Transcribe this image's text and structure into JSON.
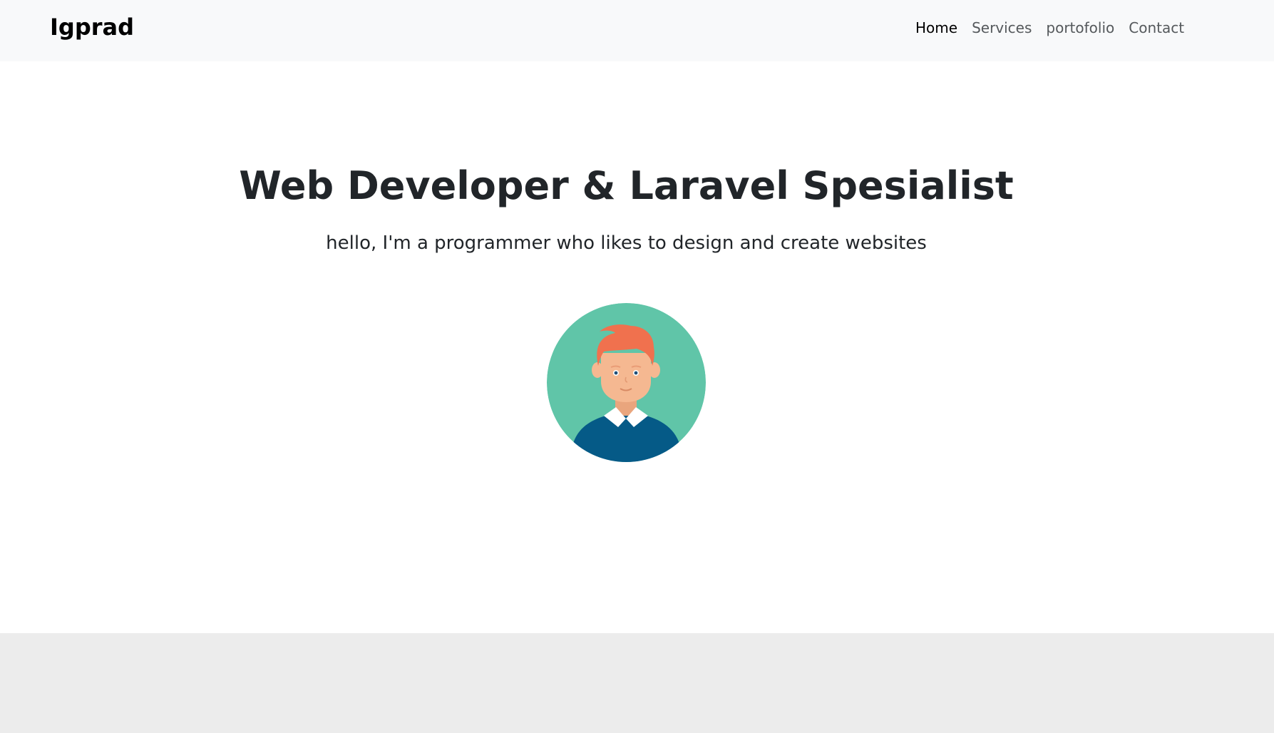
{
  "navbar": {
    "brand": "Igprad",
    "links": [
      {
        "label": "Home",
        "active": true
      },
      {
        "label": "Services",
        "active": false
      },
      {
        "label": "portofolio",
        "active": false
      },
      {
        "label": "Contact",
        "active": false
      }
    ]
  },
  "hero": {
    "title": "Web Developer & Laravel Spesialist",
    "lead": "hello, I'm a programmer who likes to design and create websites",
    "avatar_icon": "developer-avatar-icon"
  },
  "colors": {
    "navbar_bg": "#f8f9fa",
    "avatar_bg": "#60c5a8",
    "hair": "#f0714e",
    "skin": "#f5b891",
    "sweater": "#055a87",
    "footer_bg": "#ececec"
  }
}
